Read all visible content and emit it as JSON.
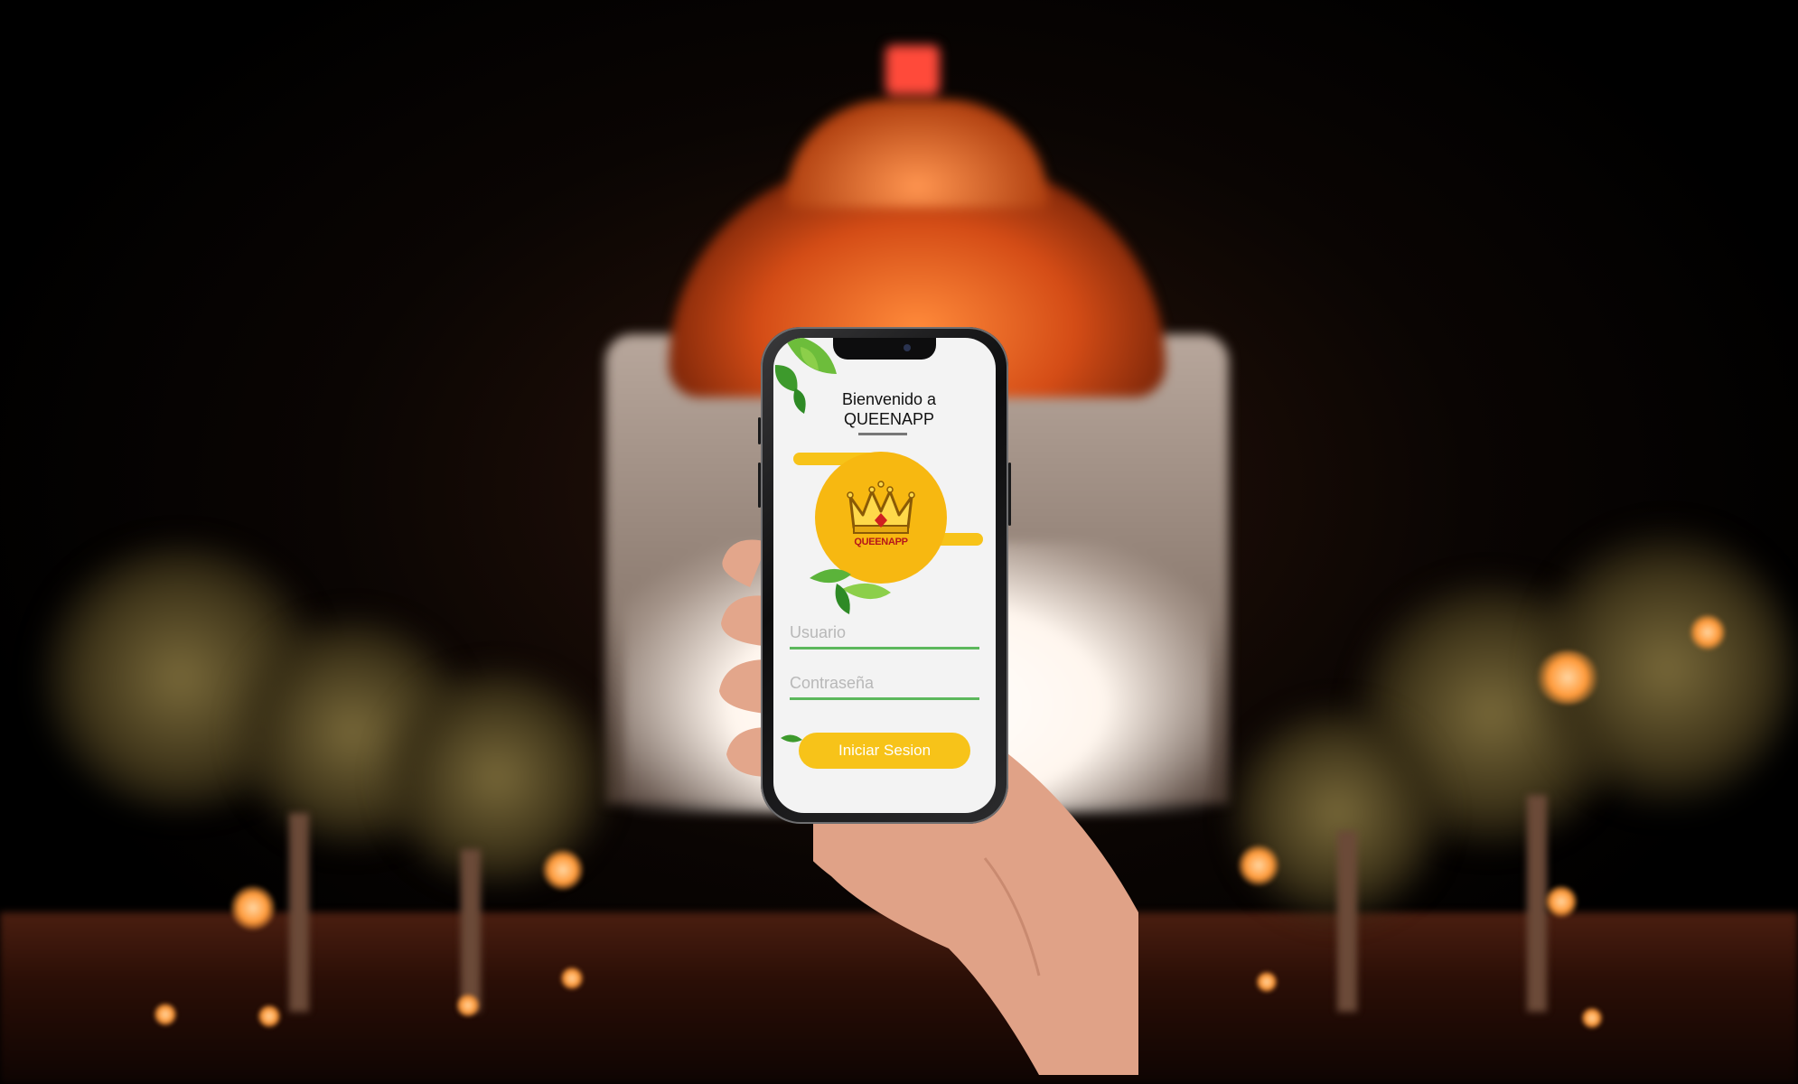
{
  "app": {
    "welcome_line1": "Bienvenido a",
    "welcome_line2": "QUEENAPP",
    "logo_text": "QUEENAPP"
  },
  "login_form": {
    "username_placeholder": "Usuario",
    "password_placeholder": "Contraseña",
    "submit_label": "Iniciar Sesion"
  },
  "colors": {
    "accent_yellow": "#f7c319",
    "field_underline": "#5cb85c",
    "screen_bg": "#f3f3f3"
  },
  "icons": [
    "crown-icon",
    "leaf-icon"
  ]
}
